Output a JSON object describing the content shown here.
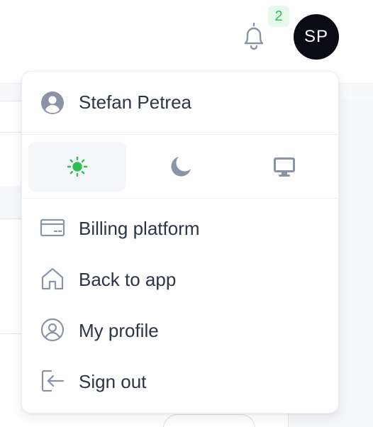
{
  "header": {
    "notification_count": "2",
    "avatar_initials": "SP",
    "accent_color": "#2fbf4f"
  },
  "menu": {
    "user_name": "Stefan Petrea",
    "theme_options": [
      {
        "name": "sun-icon",
        "active": true
      },
      {
        "name": "moon-icon",
        "active": false
      },
      {
        "name": "monitor-icon",
        "active": false
      }
    ],
    "items": [
      {
        "label": "Billing platform",
        "icon": "credit-card-icon"
      },
      {
        "label": "Back to app",
        "icon": "home-icon"
      },
      {
        "label": "My profile",
        "icon": "user-circle-icon"
      },
      {
        "label": "Sign out",
        "icon": "sign-out-icon"
      }
    ]
  }
}
